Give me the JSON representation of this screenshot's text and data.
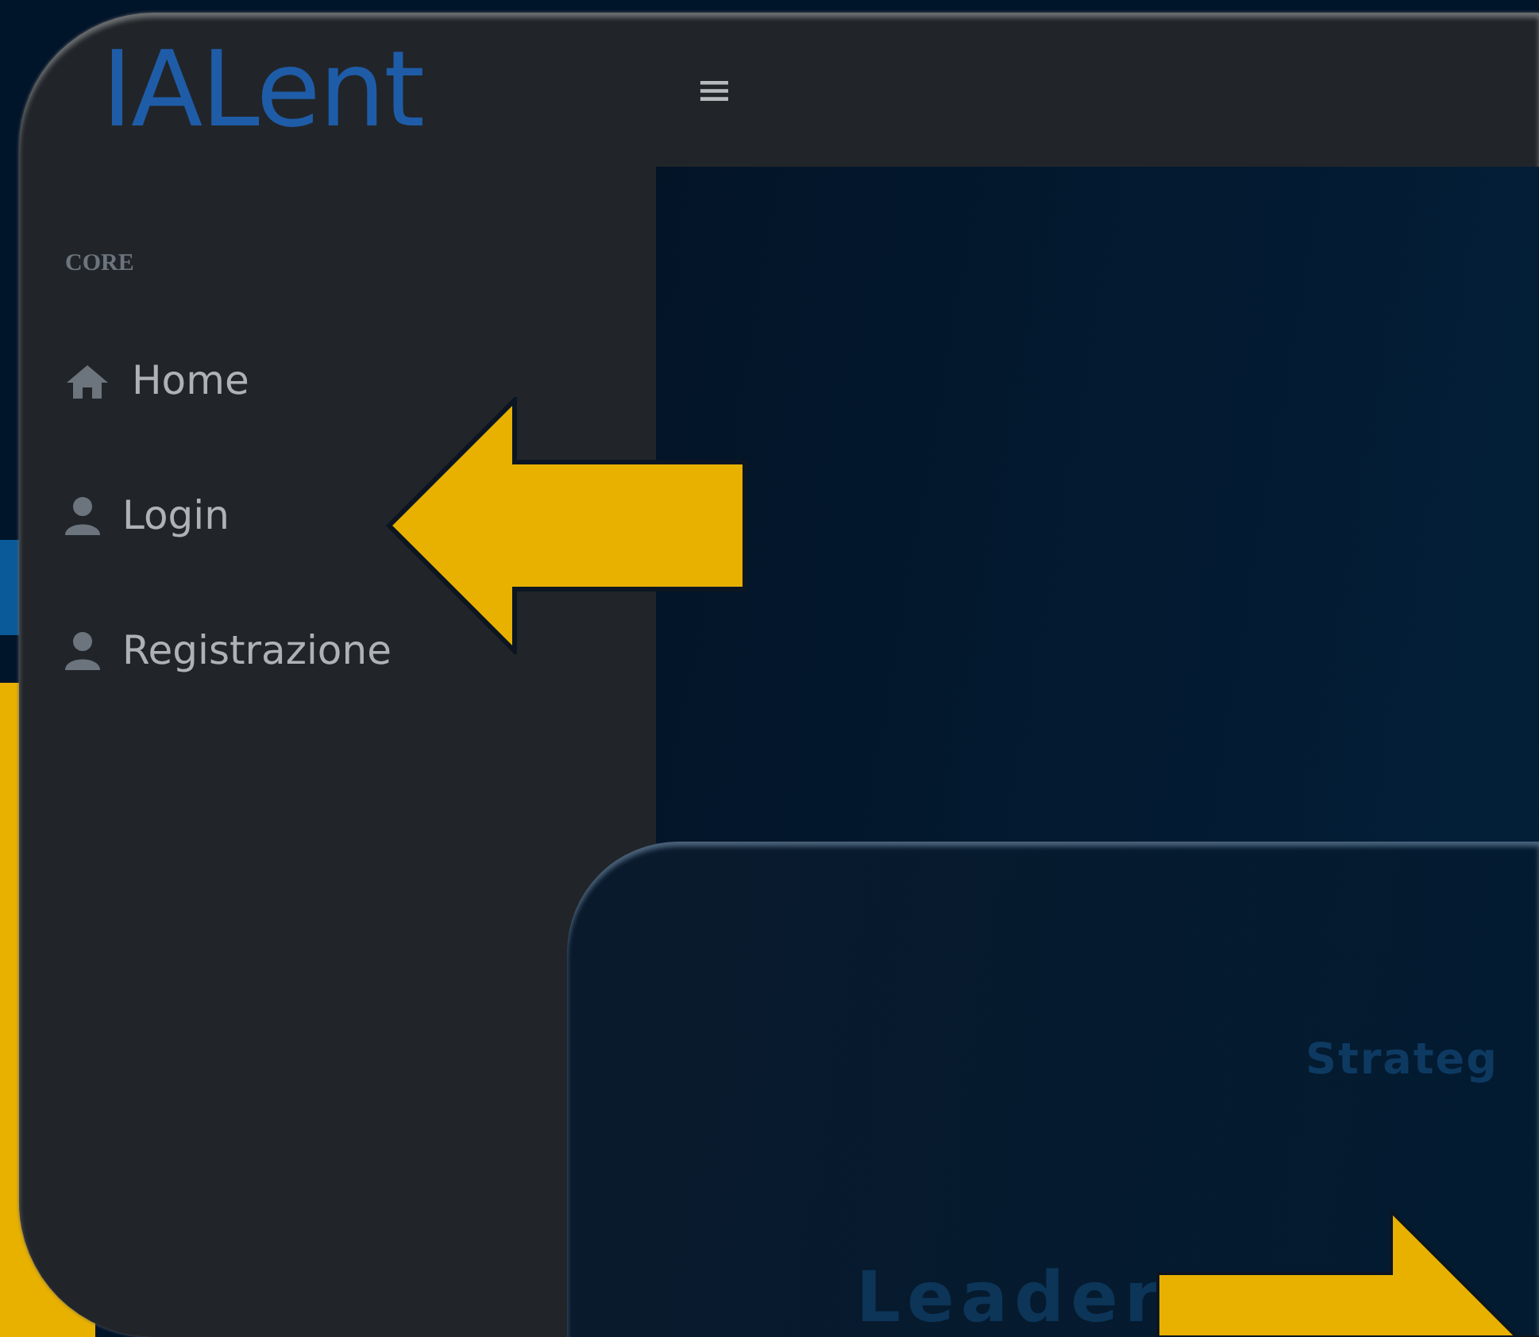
{
  "header": {
    "logo": "IALent",
    "menu_toggle": "≡"
  },
  "sidebar": {
    "heading": "CORE",
    "items": [
      {
        "kind": "home",
        "label": "Home"
      },
      {
        "kind": "user",
        "label": "Login"
      },
      {
        "kind": "user",
        "label": "Registrazione"
      }
    ]
  },
  "inset_panel": {
    "labels": [
      "Strateg",
      "Leader"
    ]
  }
}
